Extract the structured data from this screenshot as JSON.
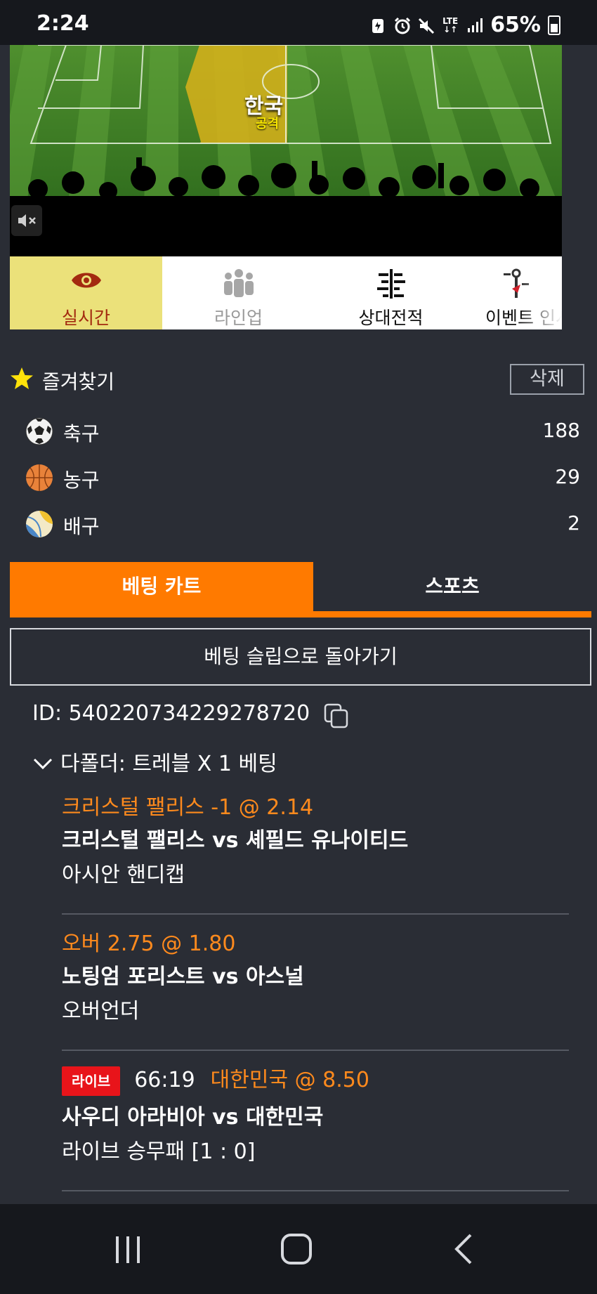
{
  "status_bar": {
    "time": "2:24",
    "battery_pct": "65%",
    "icons": [
      "battery-saver-icon",
      "alarm-icon",
      "mute-icon",
      "lte-icon",
      "signal-icon",
      "battery-icon"
    ]
  },
  "field": {
    "team": "한국",
    "action": "공격"
  },
  "viz_tabs": [
    {
      "label": "실시간",
      "icon": "eye-icon",
      "active": true
    },
    {
      "label": "라인업",
      "icon": "people-icon",
      "active": false
    },
    {
      "label": "상대전적",
      "icon": "head-to-head-icon",
      "active": false
    },
    {
      "label": "이벤트 인시",
      "icon": "event-icon",
      "active": false
    }
  ],
  "favorites": {
    "title": "즐겨찾기",
    "delete_label": "삭제",
    "sports": [
      {
        "name": "축구",
        "count": "188",
        "icon": "soccer-ball-icon"
      },
      {
        "name": "농구",
        "count": "29",
        "icon": "basketball-icon"
      },
      {
        "name": "배구",
        "count": "2",
        "icon": "volleyball-icon"
      }
    ]
  },
  "main_tabs": {
    "betting_cart": "베팅 카트",
    "sports": "스포츠"
  },
  "back_button": "베팅 슬립으로 돌아가기",
  "bet": {
    "id_text": "ID: 540220734229278720",
    "multi_label": "다폴더: 트레블 X 1 베팅",
    "selections": [
      {
        "odds": "크리스털 팰리스 -1 @ 2.14",
        "match": "크리스털 팰리스 vs 셰필드 유나이티드",
        "market": "아시안 핸디캡"
      },
      {
        "odds": "오버 2.75 @ 1.80",
        "match": "노팅엄 포리스트 vs 아스널",
        "market": "오버언더"
      },
      {
        "live_badge": "라이브",
        "live_time": "66:19",
        "odds": "대한민국 @ 8.50",
        "match": "사우디 아라비아 vs 대한민국",
        "market": "라이브 승무패 [1 : 0]"
      }
    ]
  },
  "colors": {
    "accent": "#ff7a00",
    "odds_text": "#ff8a1d",
    "live_red": "#e8141a",
    "active_tab": "#ebe17a",
    "background": "#2a2d35"
  }
}
